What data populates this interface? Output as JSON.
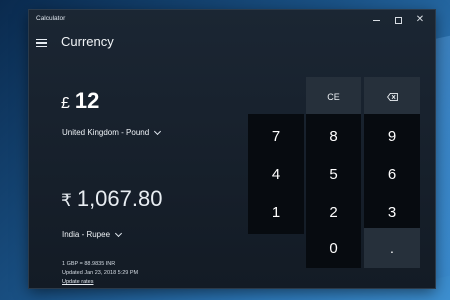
{
  "window": {
    "title": "Calculator"
  },
  "header": {
    "mode": "Currency"
  },
  "from": {
    "symbol": "£",
    "value": "12",
    "unit": "United Kingdom - Pound"
  },
  "to": {
    "symbol": "₹",
    "value": "1,067.80",
    "unit": "India - Rupee"
  },
  "rate": {
    "line1": "1 GBP = 88.9835 INR",
    "line2": "Updated Jan 23, 2018 5:29 PM",
    "link": "Update rates"
  },
  "keypad": {
    "ce": "CE",
    "k7": "7",
    "k8": "8",
    "k9": "9",
    "k4": "4",
    "k5": "5",
    "k6": "6",
    "k1": "1",
    "k2": "2",
    "k3": "3",
    "k0": "0",
    "decimal": "."
  },
  "colors": {
    "window_bg": "#151e28",
    "number_key": "#070b10",
    "function_key": "#26303b",
    "desktop": "#1d4f7c"
  },
  "icons": {
    "menu": "hamburger-icon",
    "backspace": "backspace-icon",
    "minimize": "minimize-icon",
    "maximize": "maximize-icon",
    "close": "close-icon",
    "dropdown": "chevron-down-icon"
  }
}
